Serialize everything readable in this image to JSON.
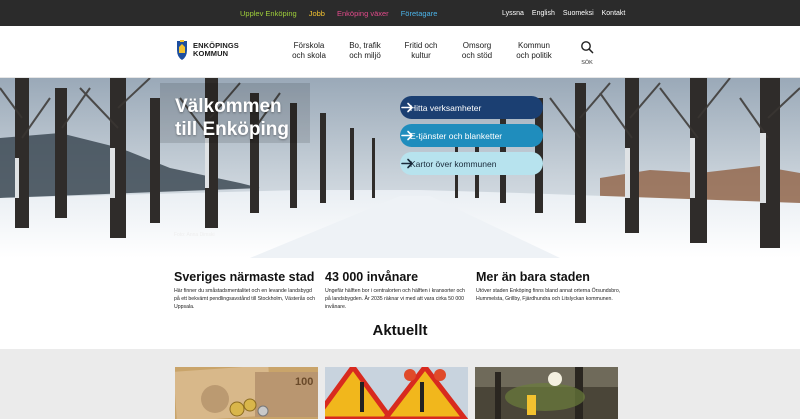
{
  "topbar": {
    "promo_links": [
      {
        "label": "Upplev Enköping",
        "color": "#9fcf3a"
      },
      {
        "label": "Jobb",
        "color": "#f2c230"
      },
      {
        "label": "Enköping växer",
        "color": "#e14a8a"
      },
      {
        "label": "Företagare",
        "color": "#4bb3e8"
      }
    ],
    "utility_links": [
      "Lyssna",
      "English",
      "Suomeksi",
      "Kontakt"
    ]
  },
  "header": {
    "logo_line1": "ENKÖPINGS",
    "logo_line2": "KOMMUN",
    "nav": [
      {
        "line1": "Förskola",
        "line2": "och skola"
      },
      {
        "line1": "Bo, trafik",
        "line2": "och miljö"
      },
      {
        "line1": "Fritid och",
        "line2": "kultur"
      },
      {
        "line1": "Omsorg",
        "line2": "och stöd"
      },
      {
        "line1": "Kommun",
        "line2": "och politik"
      }
    ],
    "search_label": "SÖK"
  },
  "hero": {
    "title_line1": "Välkommen",
    "title_line2": "till Enköping",
    "photo_credit": "Foto: Anna Dimski",
    "buttons": [
      {
        "label": "Hitta verksamheter",
        "bg": "#1b3f72",
        "fg": "#ffffff"
      },
      {
        "label": "E-tjänster och blanketter",
        "bg": "#1f8dbd",
        "fg": "#ffffff"
      },
      {
        "label": "Kartor över kommunen",
        "bg": "#b7e3ee",
        "fg": "#1a2a3a"
      }
    ]
  },
  "facts": [
    {
      "heading": "Sveriges närmaste stad",
      "text": "Här finner du småstadsmentalitet och en levande landsbygd på ett bekvämt pendlingsavstånd till Stockholm, Västerås och Uppsala."
    },
    {
      "heading": "43 000 invånare",
      "text": "Ungefär hälften bor i centralorten och hälften i kransorter och på landsbygden. År 2035 räknar vi med att vara cirka 50 000 invånare."
    },
    {
      "heading": "Mer än bara staden",
      "text": "Utöver staden Enköping finns bland annat orterna Örsundsbro, Hummelsta, Grillby, Fjärdhundra och Litslyckan kommunen."
    }
  ],
  "news": {
    "heading": "Aktuellt"
  }
}
